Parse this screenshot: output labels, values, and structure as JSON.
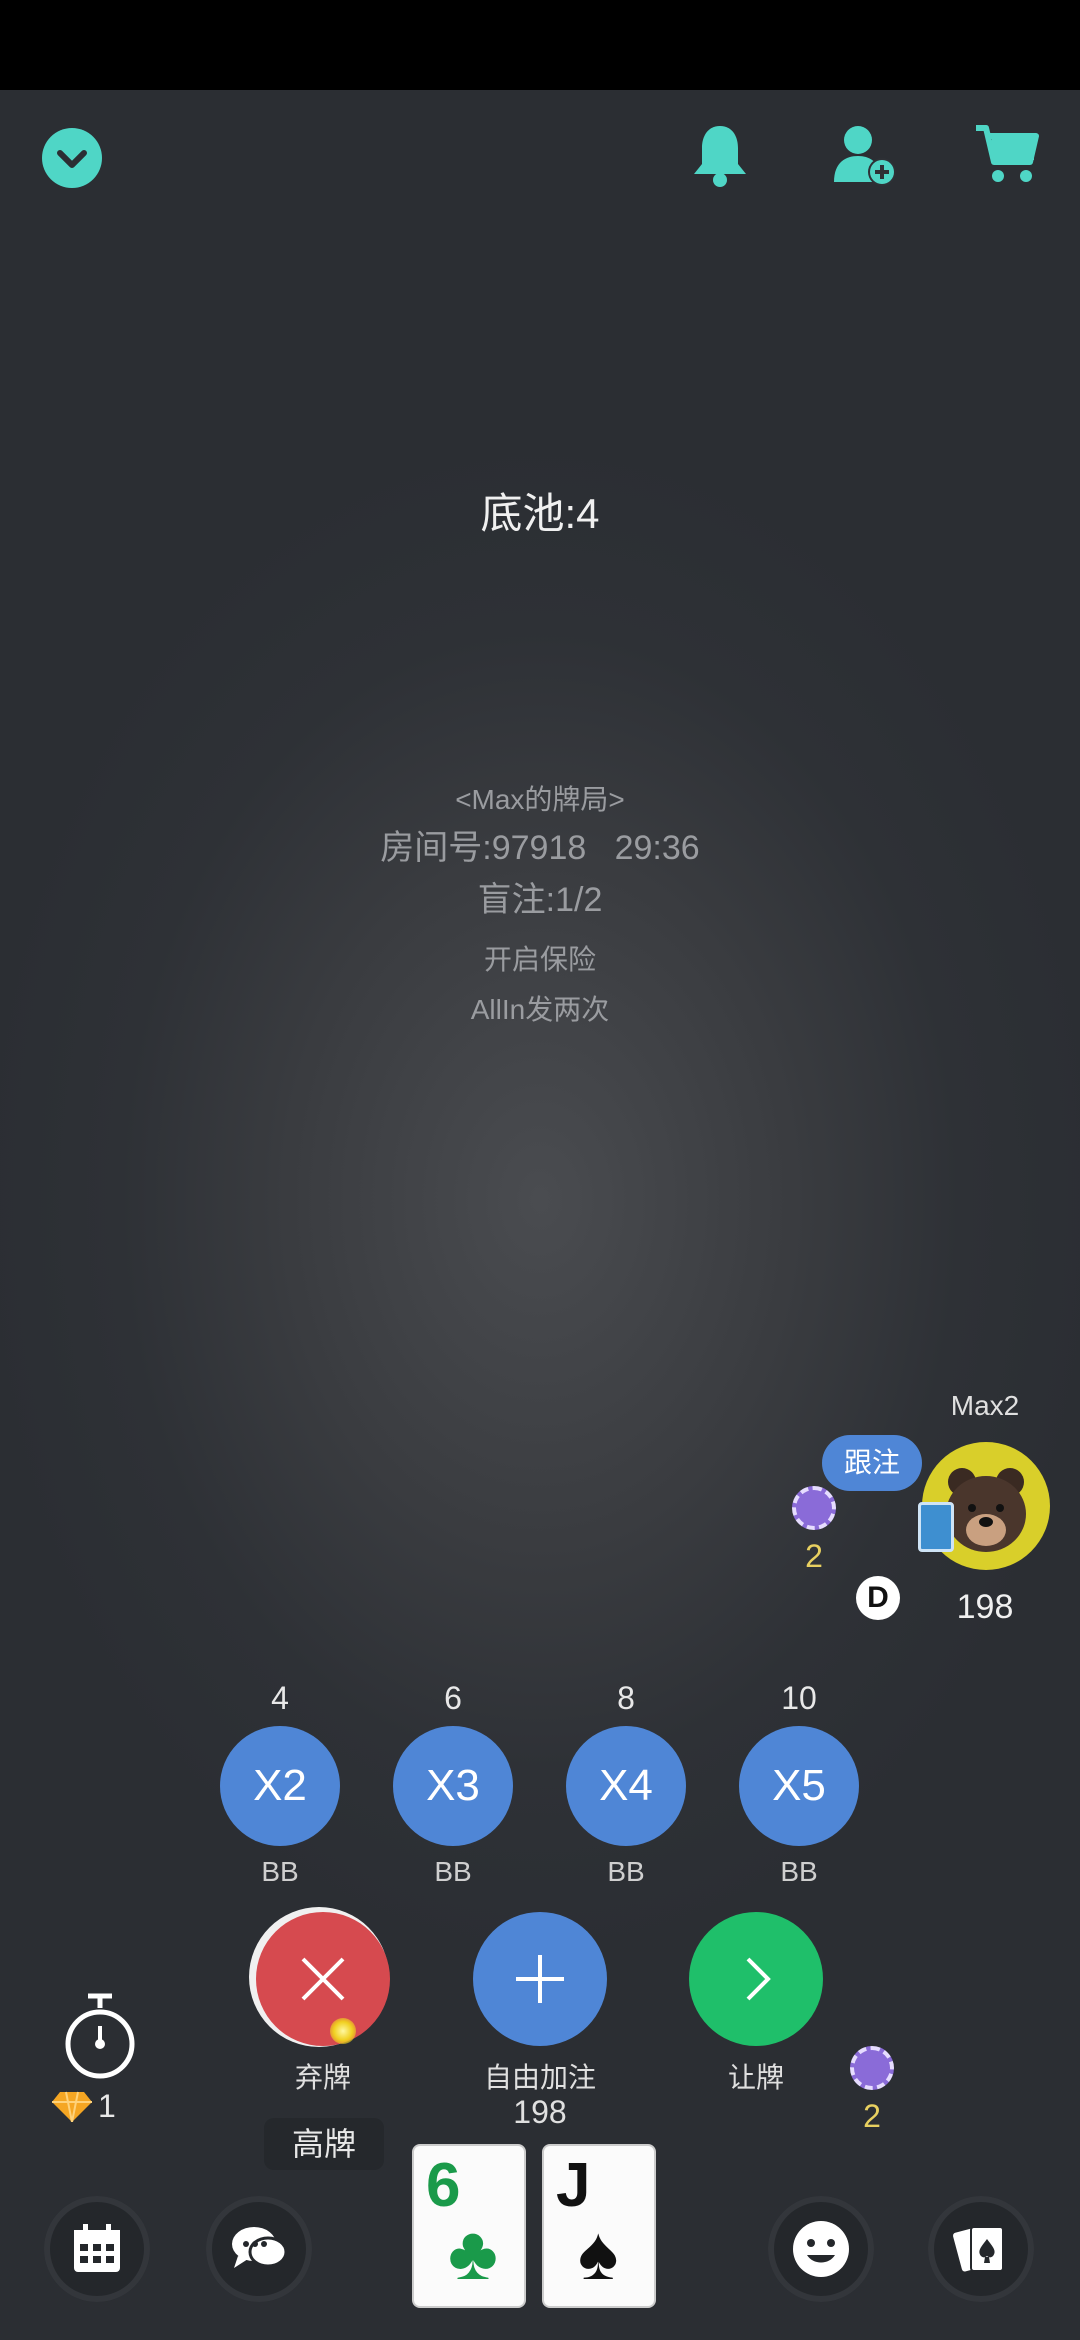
{
  "pot": {
    "label": "底池:4"
  },
  "room": {
    "name": "<Max的牌局>",
    "room_info": "房间号:97918   29:36",
    "blinds": "盲注:1/2",
    "insurance": "开启保险",
    "allin_rule": "AllIn发两次"
  },
  "player": {
    "name": "Max2",
    "action_badge": "跟注",
    "chip_bet": "2",
    "dealer_badge": "D",
    "stack": "198"
  },
  "bet_presets": [
    {
      "top": "4",
      "label": "X2",
      "bottom": "BB"
    },
    {
      "top": "6",
      "label": "X3",
      "bottom": "BB"
    },
    {
      "top": "8",
      "label": "X4",
      "bottom": "BB"
    },
    {
      "top": "10",
      "label": "X5",
      "bottom": "BB"
    }
  ],
  "actions": {
    "fold": "弃牌",
    "raise": "自由加注",
    "raise_amount": "198",
    "check": "让牌",
    "my_bet": "2"
  },
  "timer": {
    "gems": "1"
  },
  "hand": {
    "rank_label": "高牌",
    "cards": [
      {
        "rank": "6",
        "suit": "♣",
        "color": "#1a9a4a"
      },
      {
        "rank": "J",
        "suit": "♠",
        "color": "#111111"
      }
    ]
  },
  "colors": {
    "accent": "#4fd6c6",
    "fold": "#d64a4f",
    "raise": "#4f86d6",
    "check": "#1fbf6a"
  }
}
